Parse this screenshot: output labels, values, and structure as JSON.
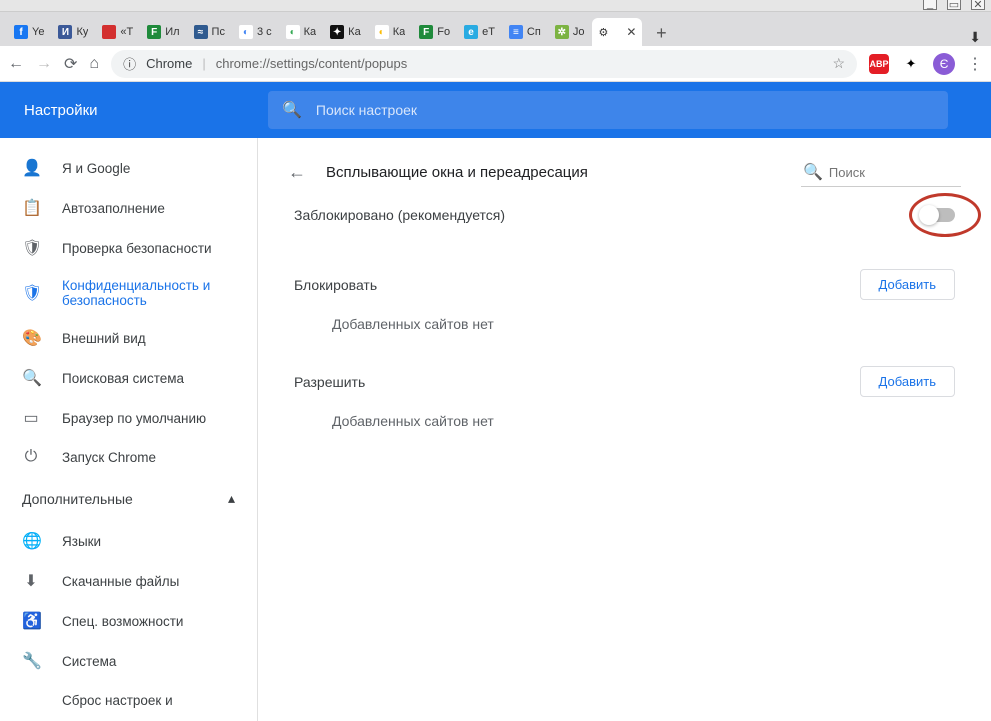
{
  "window_controls": {
    "min": "_",
    "max": "▭",
    "close": "✕"
  },
  "tabs": [
    {
      "label": "Ye",
      "favicon_bg": "#1877f2",
      "favicon_txt": "f",
      "favicon_color": "#fff"
    },
    {
      "label": "Ку",
      "favicon_bg": "#3b5998",
      "favicon_txt": "И",
      "favicon_color": "#fff"
    },
    {
      "label": "«Т",
      "favicon_bg": "#d32f2f",
      "favicon_txt": "",
      "favicon_color": "#fff"
    },
    {
      "label": "Ил",
      "favicon_bg": "#1f8a3b",
      "favicon_txt": "F",
      "favicon_color": "#fff"
    },
    {
      "label": "Пс",
      "favicon_bg": "#2f5a8f",
      "favicon_txt": "≈",
      "favicon_color": "#fff"
    },
    {
      "label": "3 с",
      "favicon_bg": "#fff",
      "favicon_txt": "◐",
      "favicon_color": "#4285f4"
    },
    {
      "label": "Ка",
      "favicon_bg": "#fff",
      "favicon_txt": "◐",
      "favicon_color": "#34a853"
    },
    {
      "label": "Ка",
      "favicon_bg": "#111",
      "favicon_txt": "✦",
      "favicon_color": "#fff"
    },
    {
      "label": "Ка",
      "favicon_bg": "#fff",
      "favicon_txt": "◐",
      "favicon_color": "#fbbc05"
    },
    {
      "label": "Fo",
      "favicon_bg": "#1f8a3b",
      "favicon_txt": "F",
      "favicon_color": "#fff"
    },
    {
      "label": "eT",
      "favicon_bg": "#29abe2",
      "favicon_txt": "e",
      "favicon_color": "#fff"
    },
    {
      "label": "Сп",
      "favicon_bg": "#4285f4",
      "favicon_txt": "≡",
      "favicon_color": "#fff"
    },
    {
      "label": "Jo",
      "favicon_bg": "#7cb342",
      "favicon_txt": "✲",
      "favicon_color": "#fff"
    }
  ],
  "active_tab": {
    "icon": "⚙",
    "close": "✕"
  },
  "addrbar": {
    "back": "←",
    "forward": "→",
    "reload": "⟳",
    "home": "⌂",
    "globe": "ⓘ",
    "brand": "Chrome",
    "url": "chrome://settings/content/popups",
    "star": "☆",
    "abp": "ABP",
    "ext": "✦",
    "avatar": "Є",
    "menu": "⋮"
  },
  "header": {
    "title": "Настройки",
    "search_placeholder": "Поиск настроек"
  },
  "sidebar": {
    "items": [
      {
        "icon": "👤",
        "label": "Я и Google"
      },
      {
        "icon": "📋",
        "label": "Автозаполнение"
      },
      {
        "icon": "🛡",
        "label": "Проверка безопасности"
      },
      {
        "icon": "🛡",
        "label": "Конфиденциальность и безопасность",
        "active": true
      },
      {
        "icon": "🎨",
        "label": "Внешний вид"
      },
      {
        "icon": "🔍",
        "label": "Поисковая система"
      },
      {
        "icon": "▭",
        "label": "Браузер по умолчанию"
      },
      {
        "icon": "⏻",
        "label": "Запуск Chrome"
      }
    ],
    "advanced": "Дополнительные",
    "advanced_arrow": "▴",
    "adv_items": [
      {
        "icon": "🌐",
        "label": "Языки"
      },
      {
        "icon": "⬇",
        "label": "Скачанные файлы"
      },
      {
        "icon": "♿",
        "label": "Спец. возможности"
      },
      {
        "icon": "🔧",
        "label": "Система"
      }
    ],
    "reset": "Сброс настроек и"
  },
  "content": {
    "back": "←",
    "title": "Всплывающие окна и переадресация",
    "search_icon": "🔍",
    "search_placeholder": "Поиск",
    "blocked_label": "Заблокировано (рекомендуется)",
    "sections": [
      {
        "title": "Блокировать",
        "add": "Добавить",
        "empty": "Добавленных сайтов нет"
      },
      {
        "title": "Разрешить",
        "add": "Добавить",
        "empty": "Добавленных сайтов нет"
      }
    ]
  }
}
